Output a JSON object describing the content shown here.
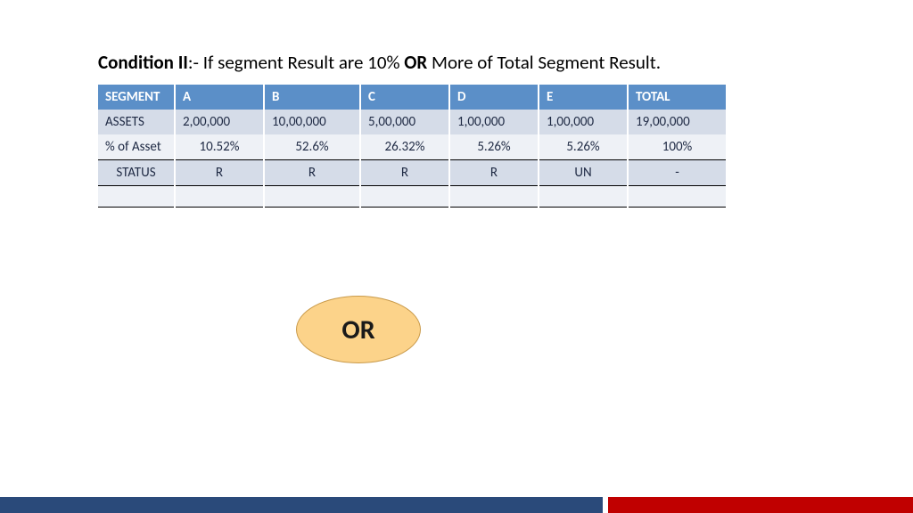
{
  "heading": {
    "prefix": "Condition II",
    "mid": ":-  If segment Result are 10% ",
    "or": "OR",
    "rest": " More of Total Segment Result."
  },
  "table": {
    "headers": {
      "seg": "SEGMENT",
      "a": "A",
      "b": "B",
      "c": "C",
      "d": "D",
      "e": "E",
      "total": "TOTAL"
    },
    "assets": {
      "label": "ASSETS",
      "a": "2,00,000",
      "b": "10,00,000",
      "c": "5,00,000",
      "d": "1,00,000",
      "e": "1,00,000",
      "total": "19,00,000"
    },
    "pct": {
      "label": "% of Asset",
      "a": "10.52%",
      "b": "52.6%",
      "c": "26.32%",
      "d": "5.26%",
      "e": "5.26%",
      "total": "100%"
    },
    "status": {
      "label": "STATUS",
      "a": "R",
      "b": "R",
      "c": "R",
      "d": "R",
      "e": "UN",
      "total": "-"
    }
  },
  "or_label": "OR"
}
